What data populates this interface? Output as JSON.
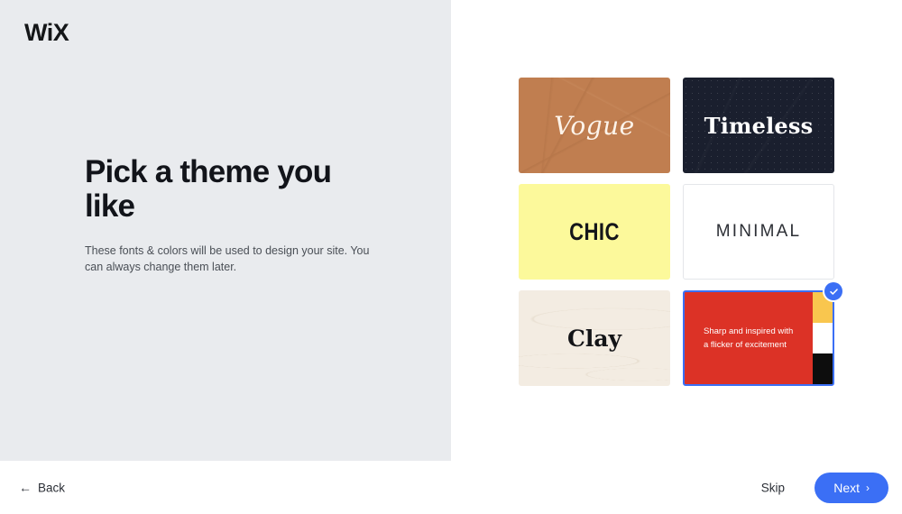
{
  "brand": {
    "logo_text": "WiX"
  },
  "left": {
    "headline": "Pick a theme you like",
    "subtext": "These fonts & colors will be used to design your site. You can always change them later."
  },
  "themes": [
    {
      "id": "vogue",
      "label": "Vogue",
      "bg": "#c07e50",
      "text_color": "#fdf4ea",
      "selected": false
    },
    {
      "id": "timeless",
      "label": "Timeless",
      "bg": "#1a1f2e",
      "text_color": "#ffffff",
      "selected": false
    },
    {
      "id": "chic",
      "label": "CHIC",
      "bg": "#fcf99b",
      "text_color": "#14161a",
      "selected": false
    },
    {
      "id": "minimal",
      "label": "MINIMAL",
      "bg": "#ffffff",
      "text_color": "#2c2f35",
      "selected": false
    },
    {
      "id": "clay",
      "label": "Clay",
      "bg": "#f3ece2",
      "text_color": "#131417",
      "selected": false
    },
    {
      "id": "sharp",
      "label": "Sharp and inspired with a flicker of excitement",
      "line1": "Sharp and inspired with",
      "line2": "a flicker of excitement",
      "bg": "#dc3226",
      "text_color": "#ffffff",
      "selected": true,
      "swatches": [
        "#f9c64e",
        "#ffffff",
        "#0d0d0d"
      ]
    }
  ],
  "footer": {
    "back_label": "Back",
    "back_arrow": "←",
    "skip_label": "Skip",
    "next_label": "Next",
    "next_chevron": "›"
  },
  "colors": {
    "panel_bg": "#e9ebee",
    "accent_blue": "#3b6ff5",
    "selection_border": "#3b6ff5"
  }
}
